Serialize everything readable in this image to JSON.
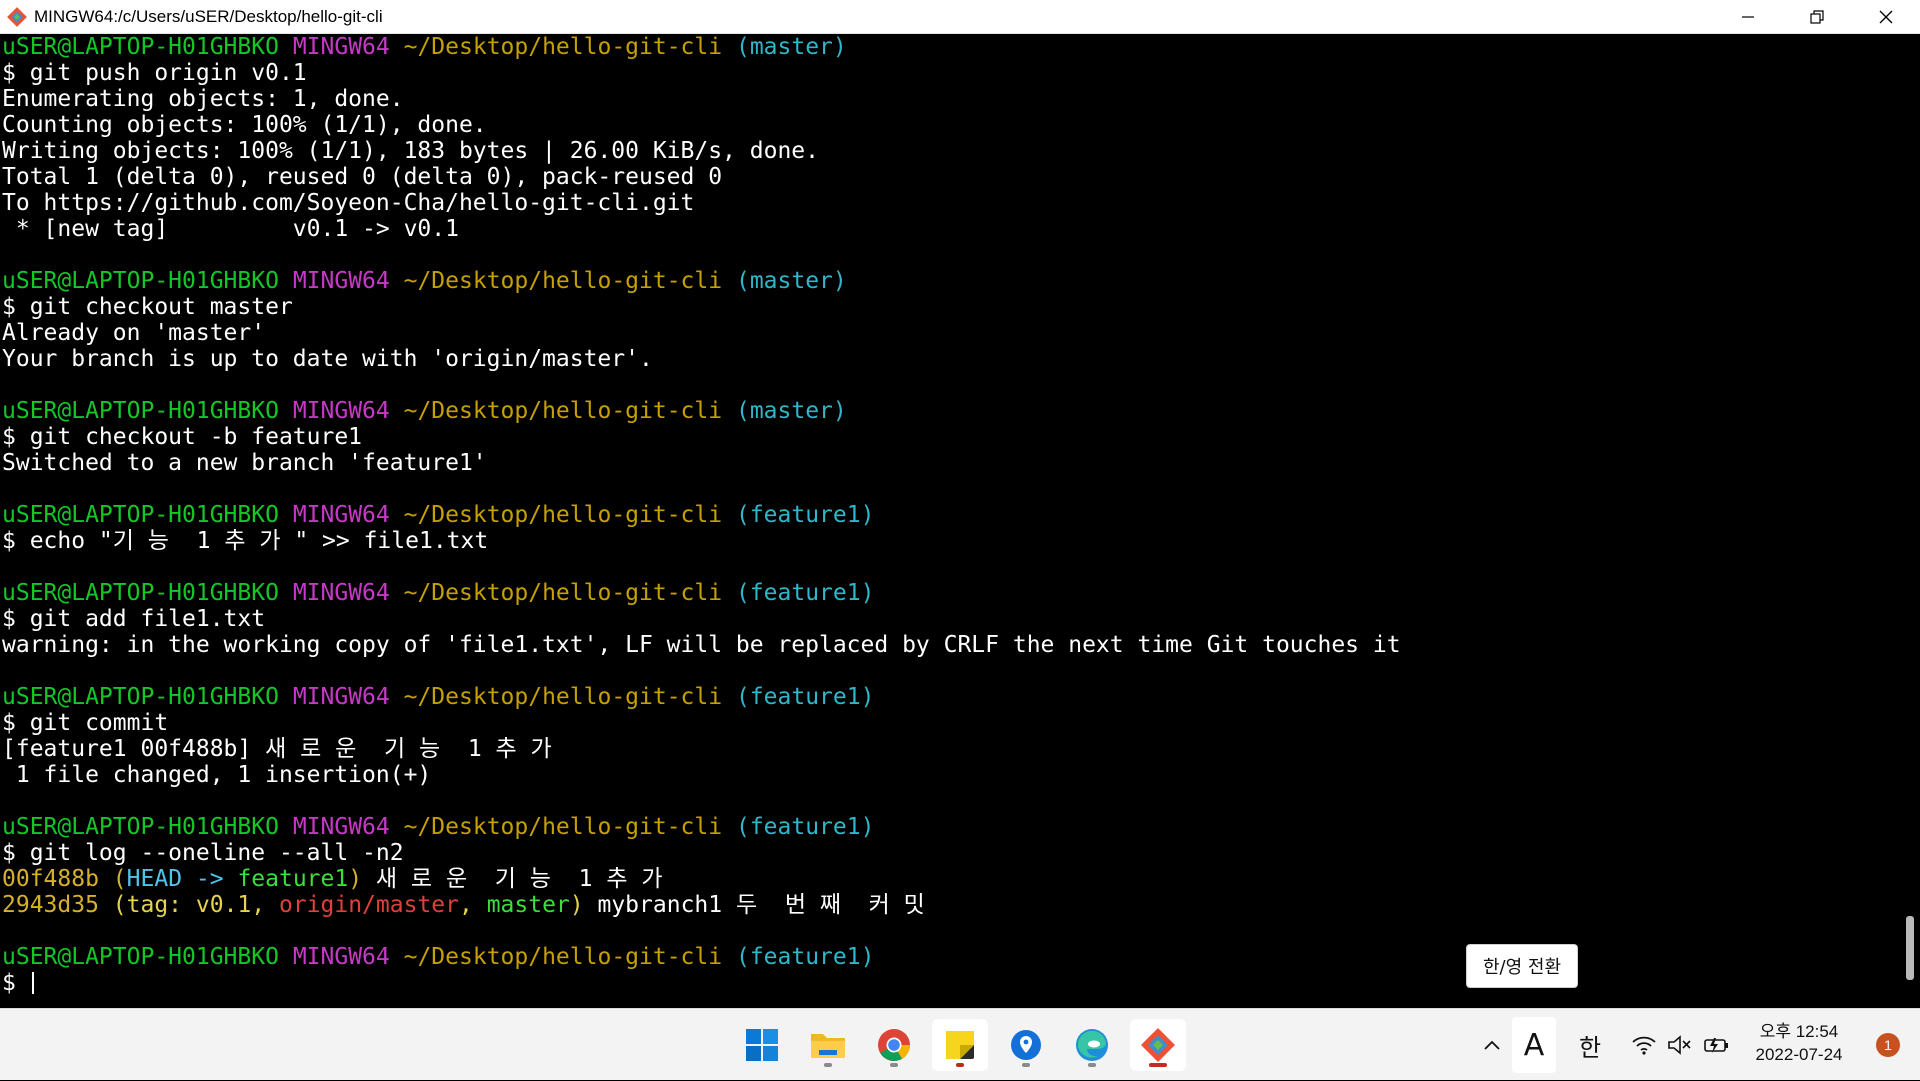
{
  "window": {
    "title": "MINGW64:/c/Users/uSER/Desktop/hello-git-cli"
  },
  "terminal": {
    "lines": [
      [
        {
          "t": "uSER@LAPTOP-H01GHBKO",
          "c": "c-green"
        },
        {
          "t": " "
        },
        {
          "t": "MINGW64",
          "c": "c-magenta"
        },
        {
          "t": " "
        },
        {
          "t": "~/Desktop/hello-git-cli",
          "c": "c-yellow"
        },
        {
          "t": " "
        },
        {
          "t": "(master)",
          "c": "c-cyan"
        }
      ],
      [
        {
          "t": "$ git push origin v0.1"
        }
      ],
      [
        {
          "t": "Enumerating objects: 1, done."
        }
      ],
      [
        {
          "t": "Counting objects: 100% (1/1), done."
        }
      ],
      [
        {
          "t": "Writing objects: 100% (1/1), 183 bytes | 26.00 KiB/s, done."
        }
      ],
      [
        {
          "t": "Total 1 (delta 0), reused 0 (delta 0), pack-reused 0"
        }
      ],
      [
        {
          "t": "To https://github.com/Soyeon-Cha/hello-git-cli.git"
        }
      ],
      [
        {
          "t": " * [new tag]         v0.1 -> v0.1"
        }
      ],
      [],
      [
        {
          "t": "uSER@LAPTOP-H01GHBKO",
          "c": "c-green"
        },
        {
          "t": " "
        },
        {
          "t": "MINGW64",
          "c": "c-magenta"
        },
        {
          "t": " "
        },
        {
          "t": "~/Desktop/hello-git-cli",
          "c": "c-yellow"
        },
        {
          "t": " "
        },
        {
          "t": "(master)",
          "c": "c-cyan"
        }
      ],
      [
        {
          "t": "$ git checkout master"
        }
      ],
      [
        {
          "t": "Already on 'master'"
        }
      ],
      [
        {
          "t": "Your branch is up to date with 'origin/master'."
        }
      ],
      [],
      [
        {
          "t": "uSER@LAPTOP-H01GHBKO",
          "c": "c-green"
        },
        {
          "t": " "
        },
        {
          "t": "MINGW64",
          "c": "c-magenta"
        },
        {
          "t": " "
        },
        {
          "t": "~/Desktop/hello-git-cli",
          "c": "c-yellow"
        },
        {
          "t": " "
        },
        {
          "t": "(master)",
          "c": "c-cyan"
        }
      ],
      [
        {
          "t": "$ git checkout -b feature1"
        }
      ],
      [
        {
          "t": "Switched to a new branch 'feature1'"
        }
      ],
      [],
      [
        {
          "t": "uSER@LAPTOP-H01GHBKO",
          "c": "c-green"
        },
        {
          "t": " "
        },
        {
          "t": "MINGW64",
          "c": "c-magenta"
        },
        {
          "t": " "
        },
        {
          "t": "~/Desktop/hello-git-cli",
          "c": "c-yellow"
        },
        {
          "t": " "
        },
        {
          "t": "(feature1)",
          "c": "c-cyan"
        }
      ],
      [
        {
          "t": "$ echo \"기 능  1 추 가 \" >> file1.txt"
        }
      ],
      [],
      [
        {
          "t": "uSER@LAPTOP-H01GHBKO",
          "c": "c-green"
        },
        {
          "t": " "
        },
        {
          "t": "MINGW64",
          "c": "c-magenta"
        },
        {
          "t": " "
        },
        {
          "t": "~/Desktop/hello-git-cli",
          "c": "c-yellow"
        },
        {
          "t": " "
        },
        {
          "t": "(feature1)",
          "c": "c-cyan"
        }
      ],
      [
        {
          "t": "$ git add file1.txt"
        }
      ],
      [
        {
          "t": "warning: in the working copy of 'file1.txt', LF will be replaced by CRLF the next time Git touches it"
        }
      ],
      [],
      [
        {
          "t": "uSER@LAPTOP-H01GHBKO",
          "c": "c-green"
        },
        {
          "t": " "
        },
        {
          "t": "MINGW64",
          "c": "c-magenta"
        },
        {
          "t": " "
        },
        {
          "t": "~/Desktop/hello-git-cli",
          "c": "c-yellow"
        },
        {
          "t": " "
        },
        {
          "t": "(feature1)",
          "c": "c-cyan"
        }
      ],
      [
        {
          "t": "$ git commit"
        }
      ],
      [
        {
          "t": "[feature1 00f488b] 새 로 운  기 능  1 추 가"
        }
      ],
      [
        {
          "t": " 1 file changed, 1 insertion(+)"
        }
      ],
      [],
      [
        {
          "t": "uSER@LAPTOP-H01GHBKO",
          "c": "c-green"
        },
        {
          "t": " "
        },
        {
          "t": "MINGW64",
          "c": "c-magenta"
        },
        {
          "t": " "
        },
        {
          "t": "~/Desktop/hello-git-cli",
          "c": "c-yellow"
        },
        {
          "t": " "
        },
        {
          "t": "(feature1)",
          "c": "c-cyan"
        }
      ],
      [
        {
          "t": "$ git log --oneline --all -n2"
        }
      ],
      [
        {
          "t": "00f488b",
          "c": "c-gold"
        },
        {
          "t": " "
        },
        {
          "t": "(",
          "c": "c-gold"
        },
        {
          "t": "HEAD -> ",
          "c": "c-cyan-b"
        },
        {
          "t": "feature1",
          "c": "c-lime"
        },
        {
          "t": ")",
          "c": "c-gold"
        },
        {
          "t": " 새 로 운  기 능  1 추 가"
        }
      ],
      [
        {
          "t": "2943d35",
          "c": "c-gold"
        },
        {
          "t": " "
        },
        {
          "t": "(tag: v0.1, ",
          "c": "c-yellow-b"
        },
        {
          "t": "origin/master",
          "c": "c-red"
        },
        {
          "t": ", ",
          "c": "c-yellow-b"
        },
        {
          "t": "master",
          "c": "c-lime"
        },
        {
          "t": ")",
          "c": "c-yellow-b"
        },
        {
          "t": " mybranch1 두  번 째  커 밋"
        }
      ],
      [],
      [
        {
          "t": "uSER@LAPTOP-H01GHBKO",
          "c": "c-green"
        },
        {
          "t": " "
        },
        {
          "t": "MINGW64",
          "c": "c-magenta"
        },
        {
          "t": " "
        },
        {
          "t": "~/Desktop/hello-git-cli",
          "c": "c-yellow"
        },
        {
          "t": " "
        },
        {
          "t": "(feature1)",
          "c": "c-cyan"
        }
      ],
      [
        {
          "t": "$ "
        }
      ]
    ]
  },
  "ime_tooltip": "한/영 전환",
  "taskbar": {
    "apps": [
      {
        "name": "start-button",
        "icon": "windows-logo-icon"
      },
      {
        "name": "file-explorer",
        "icon": "folder-icon"
      },
      {
        "name": "chrome",
        "icon": "chrome-icon"
      },
      {
        "name": "sticky-notes",
        "icon": "sticky-notes-icon"
      },
      {
        "name": "maps",
        "icon": "map-pin-icon"
      },
      {
        "name": "edge",
        "icon": "edge-icon"
      },
      {
        "name": "git-bash",
        "icon": "git-icon"
      }
    ],
    "tray": {
      "chevron": "^",
      "input_mode": "A",
      "ime_lang": "한"
    },
    "clock": {
      "time": "오후 12:54",
      "date": "2022-07-24"
    },
    "notification_count": "1"
  },
  "colors": {
    "prompt_user": "#13c729",
    "prompt_env": "#c639c6",
    "prompt_path": "#c4a000",
    "prompt_branch": "#2fb7c9"
  }
}
